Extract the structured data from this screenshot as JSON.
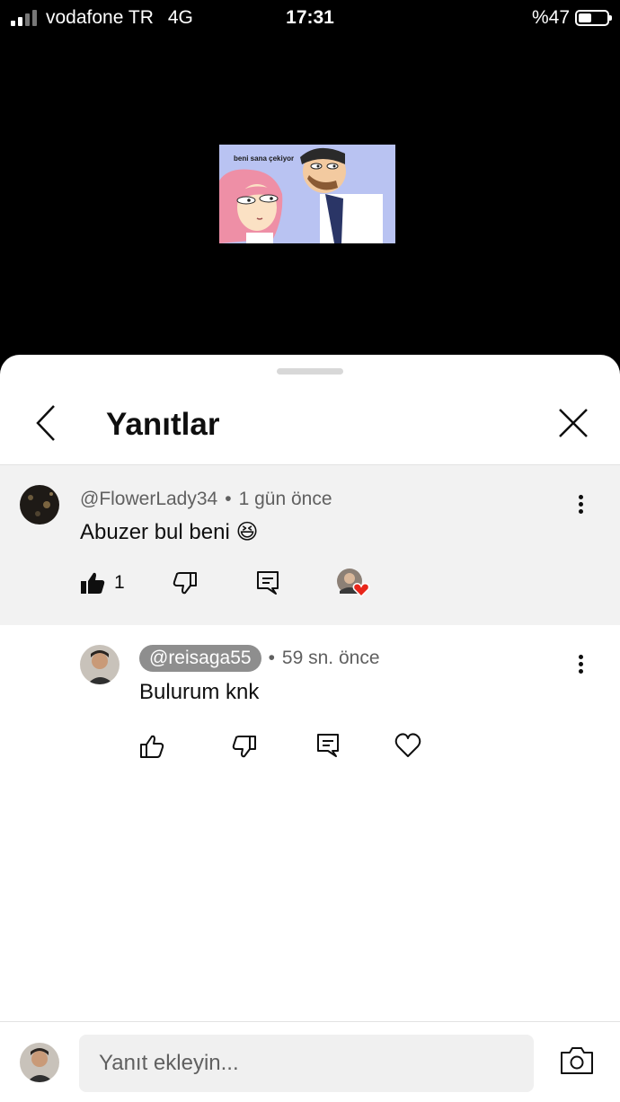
{
  "status_bar": {
    "carrier": "vodafone TR",
    "network": "4G",
    "time": "17:31",
    "battery": "%47",
    "battery_level": 0.47
  },
  "video": {
    "caption": "beni sana çekiyor"
  },
  "panel": {
    "title": "Yanıtlar",
    "back_icon": "chevron-left-icon",
    "close_icon": "close-icon"
  },
  "parent_comment": {
    "author": "@FlowerLady34",
    "separator": "•",
    "time": "1 gün önce",
    "text": "Abuzer bul beni",
    "emoji": "😆",
    "like_count": "1"
  },
  "reply_comment": {
    "author": "@reisaga55",
    "separator": "•",
    "time": "59 sn. önce",
    "text": "Bulurum knk"
  },
  "composer": {
    "placeholder": "Yanıt ekleyin..."
  },
  "colors": {
    "heart": "#e8261a",
    "parent_bg": "#f2f2f2",
    "handle_pill": "#8e8e8e"
  }
}
